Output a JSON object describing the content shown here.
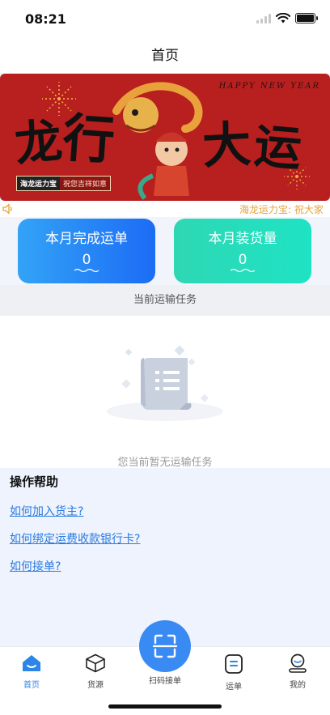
{
  "status_bar": {
    "time": "08:21"
  },
  "nav": {
    "title": "首页"
  },
  "banner": {
    "greeting": "HAPPY NEW YEAR",
    "chars": [
      "龙",
      "行",
      "大",
      "运"
    ],
    "brand": "海龙运力宝",
    "wish": "祝您吉祥如意"
  },
  "notice": {
    "text": "海龙运力宝: 祝大家"
  },
  "stats": [
    {
      "label": "本月完成运单",
      "value": "0"
    },
    {
      "label": "本月装货量",
      "value": "0"
    }
  ],
  "tasks": {
    "header": "当前运输任务",
    "empty_message": "您当前暂无运输任务"
  },
  "help": {
    "title": "操作帮助",
    "links": [
      "如何加入货主?",
      "如何绑定运费收款银行卡?",
      "如何接单?"
    ]
  },
  "tabbar": {
    "items": [
      {
        "label": "首页",
        "icon": "home-icon",
        "active": true
      },
      {
        "label": "货源",
        "icon": "box-icon",
        "active": false
      },
      {
        "label": "扫码接单",
        "icon": "scan-icon",
        "active": false
      },
      {
        "label": "运单",
        "icon": "waybill-icon",
        "active": false
      },
      {
        "label": "我的",
        "icon": "user-icon",
        "active": false
      }
    ]
  },
  "colors": {
    "accent": "#2c86e6",
    "stat_blue": "#1c6cf5",
    "stat_teal": "#1ee3c4",
    "banner_red": "#b81f1f",
    "notice_text": "#e6a23c",
    "link": "#2a7be0"
  }
}
